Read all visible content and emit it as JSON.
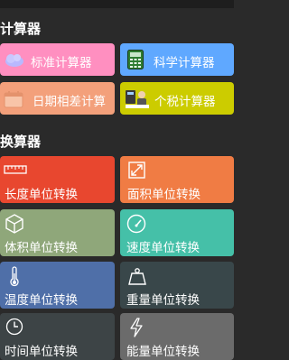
{
  "sections": {
    "calculators_title": "计算器",
    "converters_title": "换算器"
  },
  "calculators": [
    {
      "label": "标准计算器",
      "icon": "calculator-cloud-icon",
      "color": "#ff8fc0"
    },
    {
      "label": "科学计算器",
      "icon": "calculator-icon",
      "color": "#5fa8ff"
    },
    {
      "label": "日期相差计算",
      "icon": "calendar-icon",
      "color": "#f3a07b"
    },
    {
      "label": "个税计算器",
      "icon": "tax-icon",
      "color": "#cccc00"
    }
  ],
  "converters": [
    {
      "label": "长度单位转换",
      "icon": "ruler-icon",
      "color": "#e8472f"
    },
    {
      "label": "面积单位转换",
      "icon": "area-icon",
      "color": "#f07c44"
    },
    {
      "label": "体积单位转换",
      "icon": "cube-icon",
      "color": "#8fa77a"
    },
    {
      "label": "速度单位转换",
      "icon": "speedometer-icon",
      "color": "#45c0a8"
    },
    {
      "label": "温度单位转换",
      "icon": "thermometer-icon",
      "color": "#4f6fa8"
    },
    {
      "label": "重量单位转换",
      "icon": "weight-icon",
      "color": "#39474a"
    },
    {
      "label": "时间单位转换",
      "icon": "clock-icon",
      "color": "#3d4446"
    },
    {
      "label": "能量单位转换",
      "icon": "lightning-icon",
      "color": "#6b6b6b"
    }
  ]
}
